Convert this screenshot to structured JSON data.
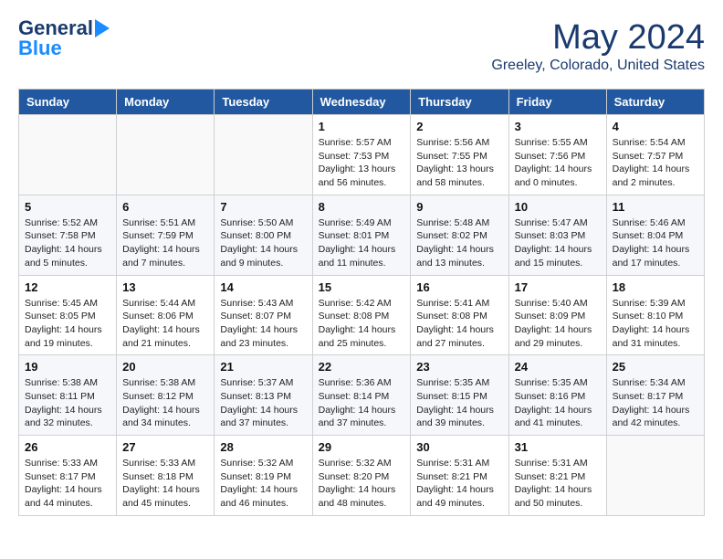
{
  "header": {
    "logo_general": "General",
    "logo_blue": "Blue",
    "month": "May 2024",
    "location": "Greeley, Colorado, United States"
  },
  "weekdays": [
    "Sunday",
    "Monday",
    "Tuesday",
    "Wednesday",
    "Thursday",
    "Friday",
    "Saturday"
  ],
  "weeks": [
    [
      {
        "day": "",
        "info": ""
      },
      {
        "day": "",
        "info": ""
      },
      {
        "day": "",
        "info": ""
      },
      {
        "day": "1",
        "info": "Sunrise: 5:57 AM\nSunset: 7:53 PM\nDaylight: 13 hours\nand 56 minutes."
      },
      {
        "day": "2",
        "info": "Sunrise: 5:56 AM\nSunset: 7:55 PM\nDaylight: 13 hours\nand 58 minutes."
      },
      {
        "day": "3",
        "info": "Sunrise: 5:55 AM\nSunset: 7:56 PM\nDaylight: 14 hours\nand 0 minutes."
      },
      {
        "day": "4",
        "info": "Sunrise: 5:54 AM\nSunset: 7:57 PM\nDaylight: 14 hours\nand 2 minutes."
      }
    ],
    [
      {
        "day": "5",
        "info": "Sunrise: 5:52 AM\nSunset: 7:58 PM\nDaylight: 14 hours\nand 5 minutes."
      },
      {
        "day": "6",
        "info": "Sunrise: 5:51 AM\nSunset: 7:59 PM\nDaylight: 14 hours\nand 7 minutes."
      },
      {
        "day": "7",
        "info": "Sunrise: 5:50 AM\nSunset: 8:00 PM\nDaylight: 14 hours\nand 9 minutes."
      },
      {
        "day": "8",
        "info": "Sunrise: 5:49 AM\nSunset: 8:01 PM\nDaylight: 14 hours\nand 11 minutes."
      },
      {
        "day": "9",
        "info": "Sunrise: 5:48 AM\nSunset: 8:02 PM\nDaylight: 14 hours\nand 13 minutes."
      },
      {
        "day": "10",
        "info": "Sunrise: 5:47 AM\nSunset: 8:03 PM\nDaylight: 14 hours\nand 15 minutes."
      },
      {
        "day": "11",
        "info": "Sunrise: 5:46 AM\nSunset: 8:04 PM\nDaylight: 14 hours\nand 17 minutes."
      }
    ],
    [
      {
        "day": "12",
        "info": "Sunrise: 5:45 AM\nSunset: 8:05 PM\nDaylight: 14 hours\nand 19 minutes."
      },
      {
        "day": "13",
        "info": "Sunrise: 5:44 AM\nSunset: 8:06 PM\nDaylight: 14 hours\nand 21 minutes."
      },
      {
        "day": "14",
        "info": "Sunrise: 5:43 AM\nSunset: 8:07 PM\nDaylight: 14 hours\nand 23 minutes."
      },
      {
        "day": "15",
        "info": "Sunrise: 5:42 AM\nSunset: 8:08 PM\nDaylight: 14 hours\nand 25 minutes."
      },
      {
        "day": "16",
        "info": "Sunrise: 5:41 AM\nSunset: 8:08 PM\nDaylight: 14 hours\nand 27 minutes."
      },
      {
        "day": "17",
        "info": "Sunrise: 5:40 AM\nSunset: 8:09 PM\nDaylight: 14 hours\nand 29 minutes."
      },
      {
        "day": "18",
        "info": "Sunrise: 5:39 AM\nSunset: 8:10 PM\nDaylight: 14 hours\nand 31 minutes."
      }
    ],
    [
      {
        "day": "19",
        "info": "Sunrise: 5:38 AM\nSunset: 8:11 PM\nDaylight: 14 hours\nand 32 minutes."
      },
      {
        "day": "20",
        "info": "Sunrise: 5:38 AM\nSunset: 8:12 PM\nDaylight: 14 hours\nand 34 minutes."
      },
      {
        "day": "21",
        "info": "Sunrise: 5:37 AM\nSunset: 8:13 PM\nDaylight: 14 hours\nand 37 minutes."
      },
      {
        "day": "22",
        "info": "Sunrise: 5:36 AM\nSunset: 8:14 PM\nDaylight: 14 hours\nand 37 minutes."
      },
      {
        "day": "23",
        "info": "Sunrise: 5:35 AM\nSunset: 8:15 PM\nDaylight: 14 hours\nand 39 minutes."
      },
      {
        "day": "24",
        "info": "Sunrise: 5:35 AM\nSunset: 8:16 PM\nDaylight: 14 hours\nand 41 minutes."
      },
      {
        "day": "25",
        "info": "Sunrise: 5:34 AM\nSunset: 8:17 PM\nDaylight: 14 hours\nand 42 minutes."
      }
    ],
    [
      {
        "day": "26",
        "info": "Sunrise: 5:33 AM\nSunset: 8:17 PM\nDaylight: 14 hours\nand 44 minutes."
      },
      {
        "day": "27",
        "info": "Sunrise: 5:33 AM\nSunset: 8:18 PM\nDaylight: 14 hours\nand 45 minutes."
      },
      {
        "day": "28",
        "info": "Sunrise: 5:32 AM\nSunset: 8:19 PM\nDaylight: 14 hours\nand 46 minutes."
      },
      {
        "day": "29",
        "info": "Sunrise: 5:32 AM\nSunset: 8:20 PM\nDaylight: 14 hours\nand 48 minutes."
      },
      {
        "day": "30",
        "info": "Sunrise: 5:31 AM\nSunset: 8:21 PM\nDaylight: 14 hours\nand 49 minutes."
      },
      {
        "day": "31",
        "info": "Sunrise: 5:31 AM\nSunset: 8:21 PM\nDaylight: 14 hours\nand 50 minutes."
      },
      {
        "day": "",
        "info": ""
      }
    ]
  ]
}
